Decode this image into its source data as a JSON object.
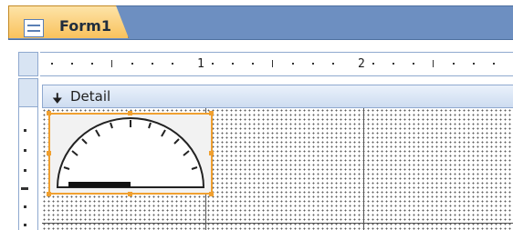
{
  "tabs": [
    {
      "label": "Form1",
      "icon": "form-icon"
    }
  ],
  "ruler": {
    "marks": [
      "1",
      "2"
    ]
  },
  "section": {
    "label": "Detail",
    "icon": "section-arrow-icon"
  },
  "colors": {
    "accent": "#f0a030",
    "tab_gradient_top": "#fde3a7",
    "tab_gradient_bottom": "#f9c25d",
    "tabstrip": "#6d8fc1",
    "section_header": "#cddcf0",
    "ruler_border": "#8fa9cf"
  },
  "controls": [
    {
      "type": "gauge",
      "selected": true,
      "icon": "gauge-icon"
    }
  ]
}
